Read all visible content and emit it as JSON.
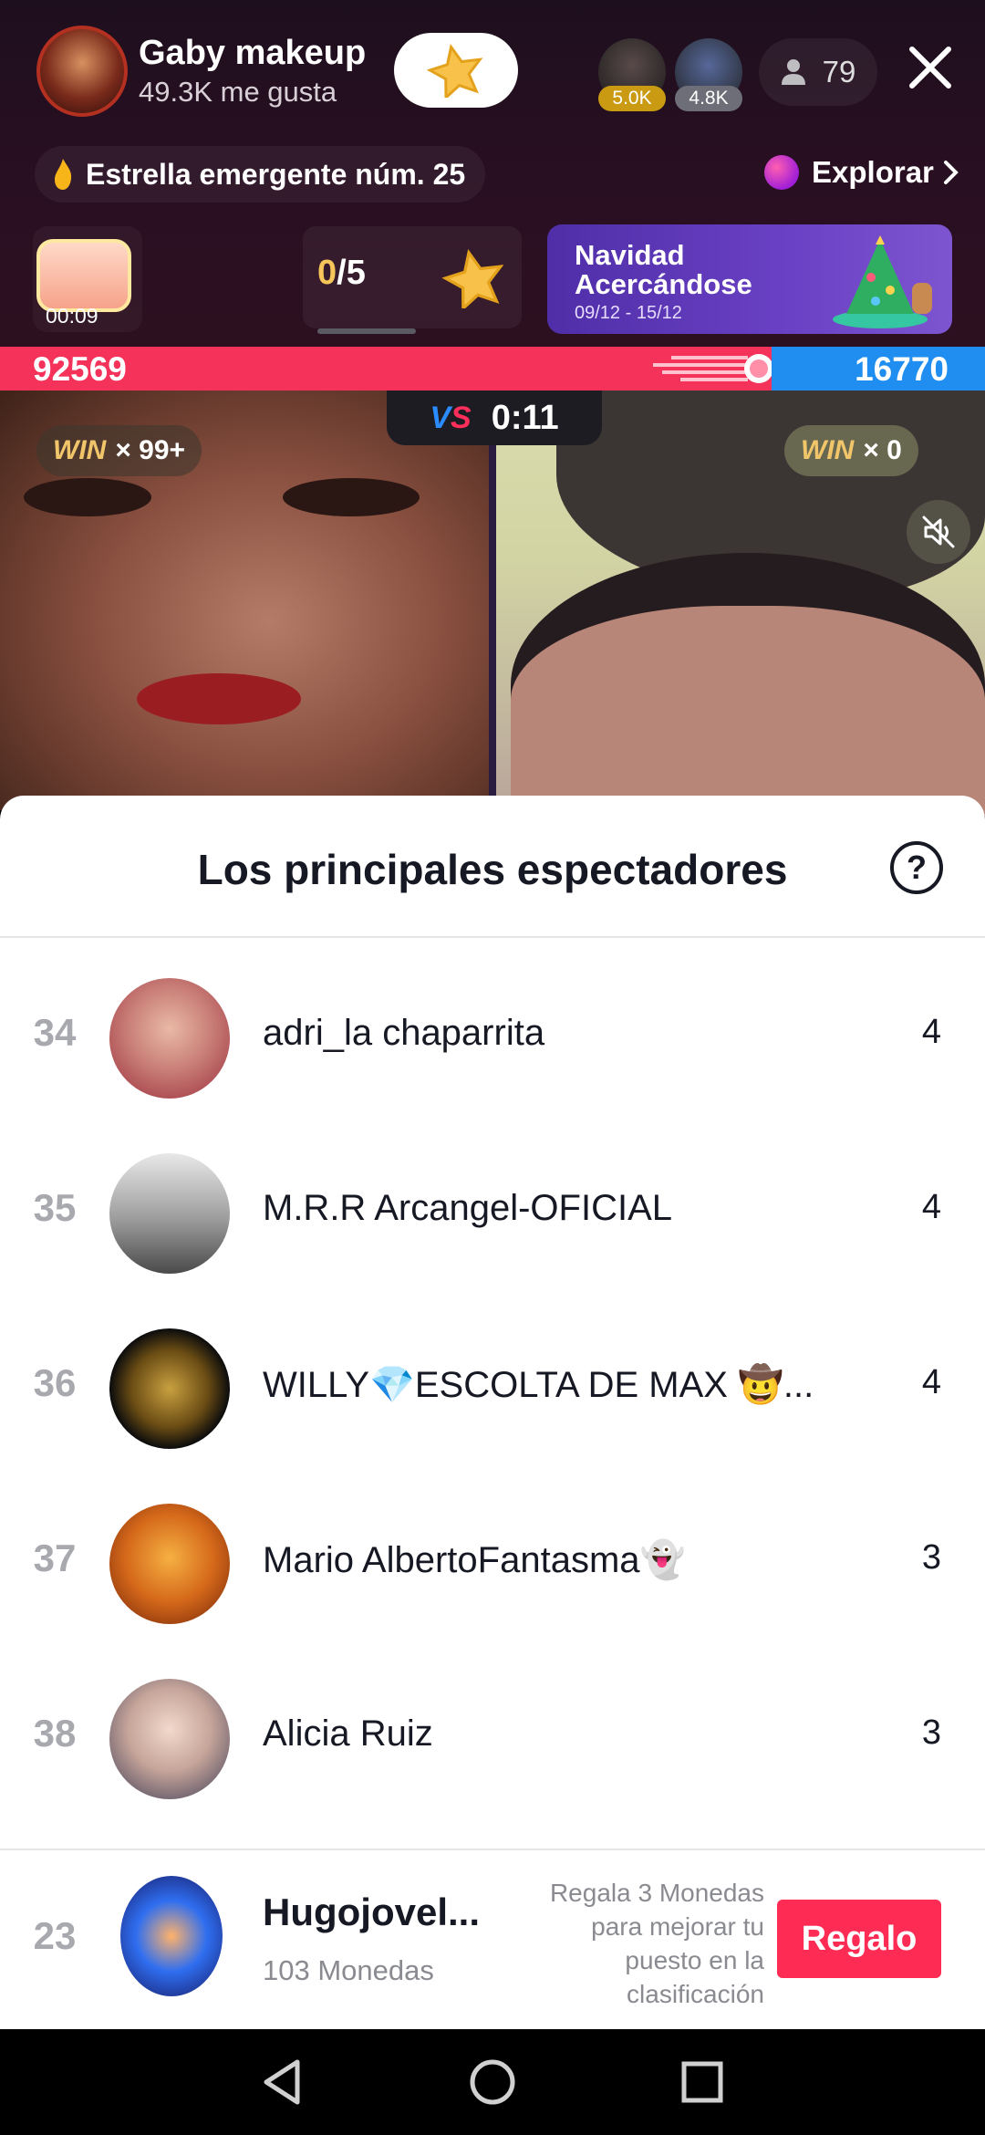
{
  "host": {
    "name": "Gaby makeup",
    "likes": "49.3K me gusta"
  },
  "top_viewers": [
    {
      "count": "5.0K"
    },
    {
      "count": "4.8K"
    }
  ],
  "viewer_count": "79",
  "rising_star": "Estrella emergente núm. 25",
  "explore_label": "Explorar",
  "treasure": {
    "timer": "00:09"
  },
  "goal": {
    "done": "0",
    "total": "/5"
  },
  "banner": {
    "line1": "Navidad",
    "line2": "Acercándose",
    "dates": "09/12 - 15/12"
  },
  "battle": {
    "left_score": "92569",
    "right_score": "16770",
    "timer": "0:11",
    "left_win": "× 99+",
    "right_win": "× 0",
    "win_label": "WIN",
    "left_fraction": 0.783
  },
  "sheet": {
    "title": "Los principales espectadores",
    "help": "?",
    "rows": [
      {
        "rank": "34",
        "name": "adri_la chaparrita",
        "count": "4"
      },
      {
        "rank": "35",
        "name": "M.R.R Arcangel-OFICIAL",
        "count": "4"
      },
      {
        "rank": "36",
        "name": "WILLY💎ESCOLTA DE MAX 🤠...",
        "count": "4"
      },
      {
        "rank": "37",
        "name": "Mario AlbertoFantasma👻",
        "count": "3"
      },
      {
        "rank": "38",
        "name": "Alicia Ruiz",
        "count": "3"
      }
    ]
  },
  "self": {
    "rank": "23",
    "name": "Hugojovel...",
    "coins": "103 Monedas",
    "hint": "Regala 3 Monedas para mejorar tu puesto en la clasificación",
    "gift_label": "Regalo"
  },
  "colors": {
    "accent_red": "#fe2c55",
    "battle_red": "#f4325a",
    "battle_blue": "#1f8ef0",
    "win_gold": "#f1c56a"
  },
  "icons": [
    "star-icon",
    "person-icon",
    "close-icon",
    "flame-icon",
    "planet-icon",
    "chevron-right-icon",
    "treasure-chest-icon",
    "christmas-tree-icon",
    "mute-icon",
    "help-icon",
    "back-icon",
    "home-icon",
    "recents-icon"
  ]
}
